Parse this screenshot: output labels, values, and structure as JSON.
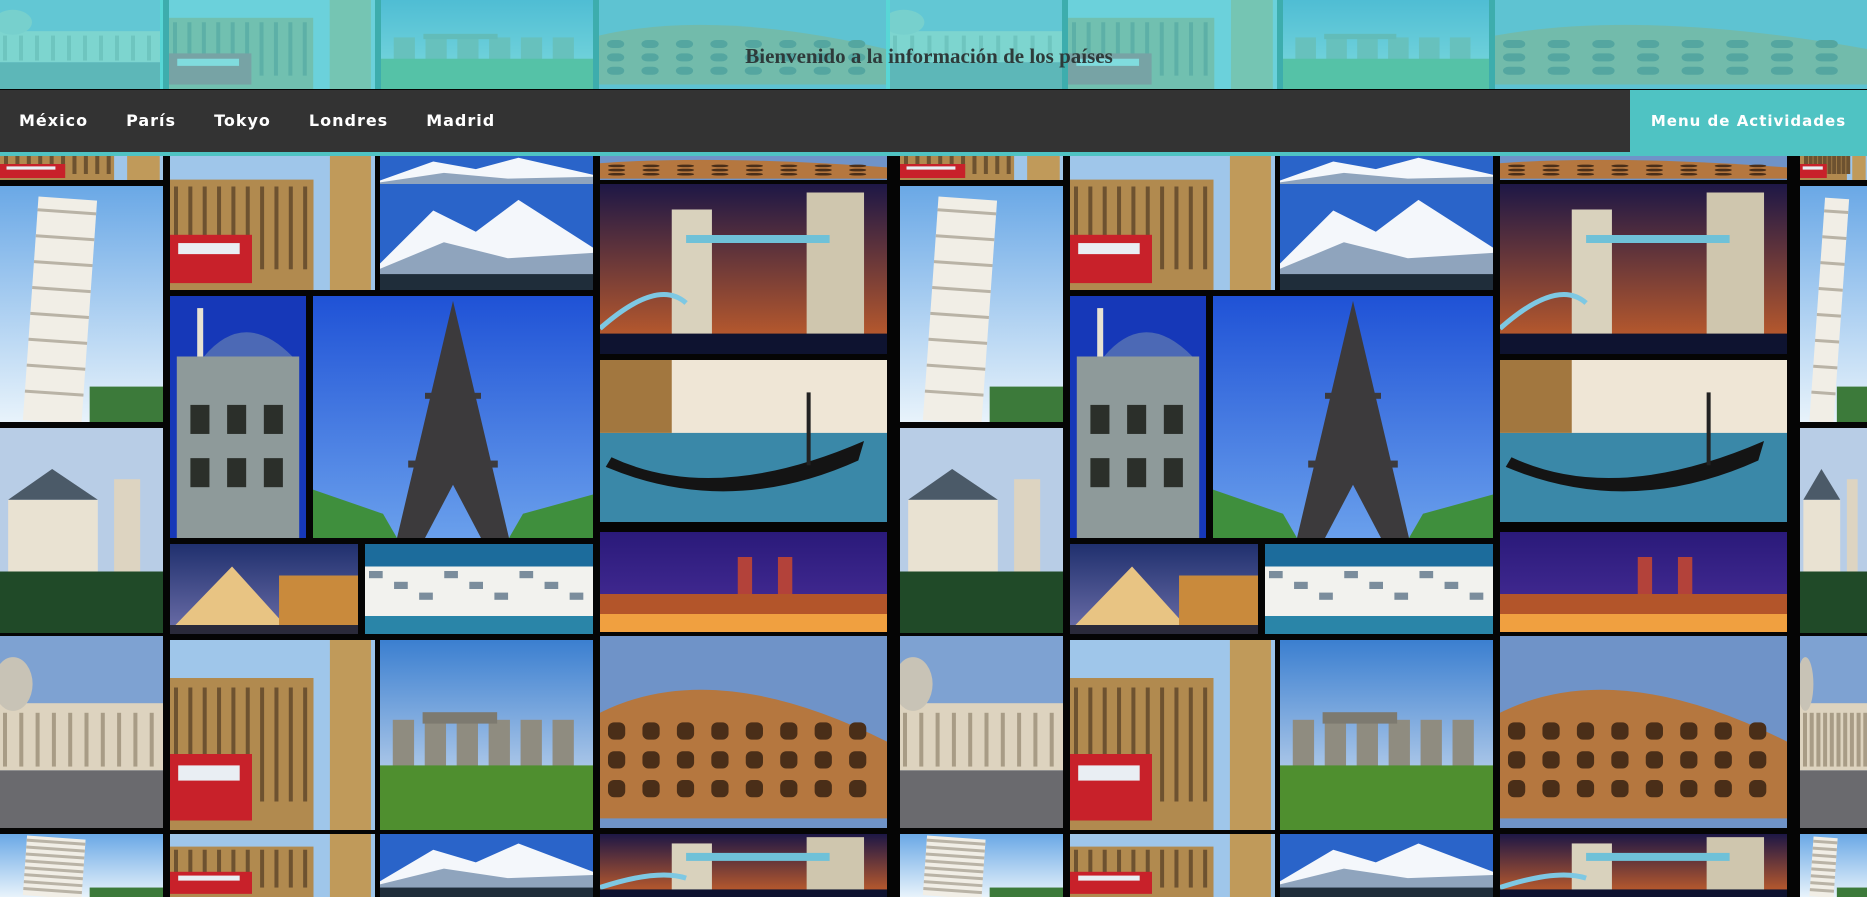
{
  "header": {
    "title": "Bienvenido a la información de los países"
  },
  "nav": {
    "items": [
      {
        "label": "México"
      },
      {
        "label": "París"
      },
      {
        "label": "Tokyo"
      },
      {
        "label": "Londres"
      },
      {
        "label": "Madrid"
      }
    ],
    "cta_label": "Menu de Actividades"
  },
  "colors": {
    "header_bg": "#60e8e8",
    "nav_bg": "#333333",
    "accent": "#4fc3c3",
    "text_light": "#ffffff",
    "title_text": "#2e3a3a"
  },
  "collage": {
    "images": [
      "pisa-tower",
      "big-ben-london",
      "snowy-mountains",
      "tower-bridge-night",
      "casa-batllo",
      "eiffel-tower",
      "venice-gondola",
      "neuschwanstein-castle",
      "louvre-pyramid",
      "mykonos-town",
      "plaza-espana-night",
      "st-peters-basilica",
      "stonehenge",
      "colosseum"
    ]
  }
}
